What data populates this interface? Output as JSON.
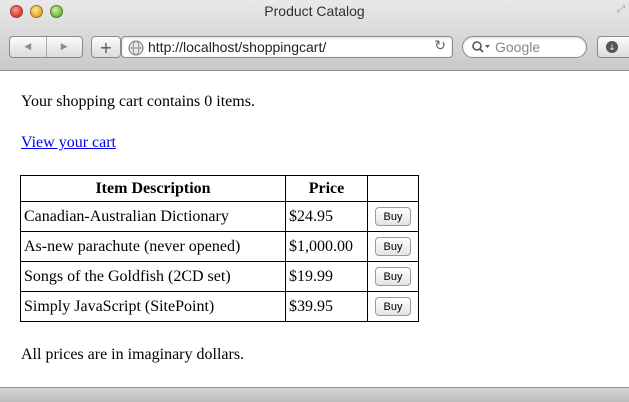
{
  "window": {
    "title": "Product Catalog"
  },
  "toolbar": {
    "back_icon": "back-arrow-icon",
    "forward_icon": "forward-arrow-icon",
    "add_icon": "plus-icon",
    "add_label": "+",
    "url": "http://localhost/shoppingcart/",
    "reload_icon": "reload-icon",
    "reload_label": "↻",
    "search_placeholder": "Google",
    "downloads_icon": "downloads-icon"
  },
  "page": {
    "cart_status": "Your shopping cart contains 0 items.",
    "view_cart_link": "View your cart",
    "table": {
      "headers": [
        "Item Description",
        "Price"
      ],
      "rows": [
        {
          "description": "Canadian-Australian Dictionary",
          "price": "$24.95",
          "button": "Buy"
        },
        {
          "description": "As-new parachute (never opened)",
          "price": "$1,000.00",
          "button": "Buy"
        },
        {
          "description": "Songs of the Goldfish (2CD set)",
          "price": "$19.99",
          "button": "Buy"
        },
        {
          "description": "Simply JavaScript (SitePoint)",
          "price": "$39.95",
          "button": "Buy"
        }
      ]
    },
    "footnote": "All prices are in imaginary dollars."
  },
  "colors": {
    "link": "#0000ee",
    "close_button": "#e0443a",
    "minimize_button": "#e7b030",
    "zoom_button": "#7cc341"
  }
}
